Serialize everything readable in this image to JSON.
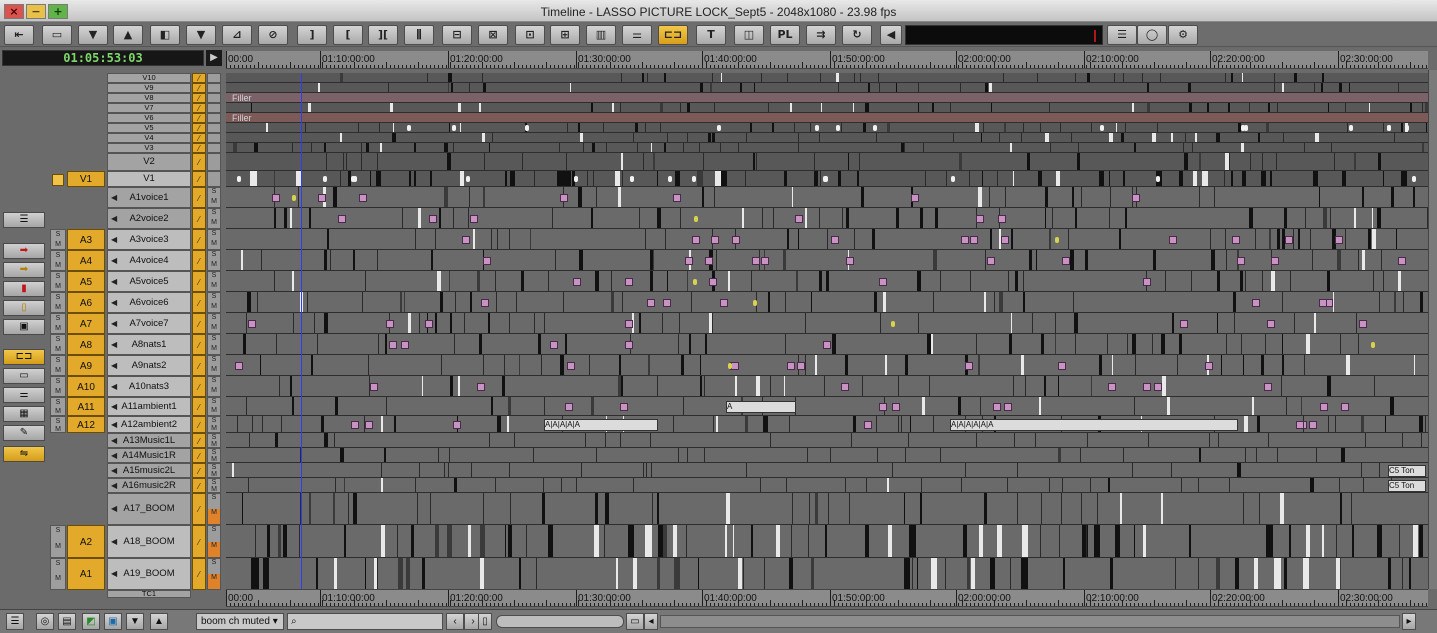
{
  "window": {
    "title": "Timeline - LASSO PICTURE LOCK_Sept5 - 2048x1080 - 23.98 fps",
    "close_label": "×",
    "minimize_label": "−",
    "maximize_label": "+"
  },
  "toolbar": {
    "buttons": [
      {
        "icon": "lift-icon",
        "glyph": "⇤"
      },
      {
        "icon": "clip-icon",
        "glyph": "▭"
      },
      {
        "icon": "down-arrow-icon",
        "glyph": "▼"
      },
      {
        "icon": "up-arrow-icon",
        "glyph": "▲"
      },
      {
        "icon": "split-icon",
        "glyph": "◧"
      },
      {
        "icon": "overwrite-icon",
        "glyph": "▼"
      },
      {
        "icon": "segment-icon",
        "glyph": "⊿"
      },
      {
        "icon": "no-entry-icon",
        "glyph": "⊘"
      },
      {
        "icon": "mark-out-icon",
        "glyph": "]"
      },
      {
        "icon": "mark-in-icon",
        "glyph": "["
      },
      {
        "icon": "mark-clip-icon",
        "glyph": "]["
      },
      {
        "icon": "clear-marks-icon",
        "glyph": "⫼"
      },
      {
        "icon": "extract-icon",
        "glyph": "⊟"
      },
      {
        "icon": "lift-segment-icon",
        "glyph": "⊠"
      },
      {
        "icon": "match-frame-icon",
        "glyph": "⊡"
      },
      {
        "icon": "trim-icon",
        "glyph": "⊞"
      },
      {
        "icon": "monitor-icon",
        "glyph": "▥"
      },
      {
        "icon": "mixer-icon",
        "glyph": "⚌"
      },
      {
        "icon": "link-icon",
        "glyph": "⊏⊐"
      },
      {
        "icon": "text-icon",
        "glyph": "T"
      },
      {
        "icon": "render-icon",
        "glyph": "◫"
      },
      {
        "icon": "pl-icon",
        "glyph": "PL"
      },
      {
        "icon": "sequence-icon",
        "glyph": "⇉"
      },
      {
        "icon": "refresh-icon",
        "glyph": "↻"
      },
      {
        "icon": "speaker-icon",
        "glyph": "◀"
      },
      {
        "icon": "list-icon",
        "glyph": "☰"
      },
      {
        "icon": "circle-icon",
        "glyph": "◯"
      },
      {
        "icon": "gear-icon",
        "glyph": "⚙"
      }
    ]
  },
  "timecode": "01:05:53:03",
  "ruler": {
    "labels": [
      "00:00",
      "01:10:00:00",
      "01:20:00:00",
      "01:30:00:00",
      "01:40:00:00",
      "01:50:00:00",
      "02:00:00:00",
      "02:10:00:00",
      "02:20:00:00",
      "02:30:00:00"
    ],
    "bottom_labels": [
      "00:00",
      "01:10:00:00",
      "01:20:00:00",
      "01:30:00:00",
      "01:40:00:00",
      "01:50:00:00",
      "02:00:00:00",
      "02:10:00:00",
      "02:20:00:00",
      "02:30:00:00"
    ]
  },
  "tracks": [
    {
      "name": "V10",
      "kind": "video"
    },
    {
      "name": "V9",
      "kind": "video"
    },
    {
      "name": "V8",
      "kind": "video"
    },
    {
      "name": "V7",
      "kind": "video"
    },
    {
      "name": "V6",
      "kind": "video"
    },
    {
      "name": "V5",
      "kind": "video"
    },
    {
      "name": "V4",
      "kind": "video"
    },
    {
      "name": "V3",
      "kind": "video"
    },
    {
      "name": "V2",
      "kind": "video"
    },
    {
      "name": "V1",
      "kind": "video",
      "patch": "V1"
    },
    {
      "name": "A1voice1",
      "kind": "audio"
    },
    {
      "name": "A2voice2",
      "kind": "audio"
    },
    {
      "name": "A3voice3",
      "kind": "audio",
      "patch": "A3"
    },
    {
      "name": "A4voice4",
      "kind": "audio",
      "patch": "A4"
    },
    {
      "name": "A5voice5",
      "kind": "audio",
      "patch": "A5"
    },
    {
      "name": "A6voice6",
      "kind": "audio",
      "patch": "A6"
    },
    {
      "name": "A7voice7",
      "kind": "audio",
      "patch": "A7"
    },
    {
      "name": "A8nats1",
      "kind": "audio",
      "patch": "A8"
    },
    {
      "name": "A9nats2",
      "kind": "audio",
      "patch": "A9"
    },
    {
      "name": "A10nats3",
      "kind": "audio",
      "patch": "A10"
    },
    {
      "name": "A11ambient1",
      "kind": "audio",
      "patch": "A11"
    },
    {
      "name": "A12ambient2",
      "kind": "audio",
      "patch": "A12"
    },
    {
      "name": "A13Music1L",
      "kind": "audio"
    },
    {
      "name": "A14Music1R",
      "kind": "audio"
    },
    {
      "name": "A15music2L",
      "kind": "audio"
    },
    {
      "name": "A16music2R",
      "kind": "audio"
    },
    {
      "name": "A17_BOOM",
      "kind": "audio"
    },
    {
      "name": "A18_BOOM",
      "kind": "audio",
      "patch": "A2"
    },
    {
      "name": "A19_BOOM",
      "kind": "audio",
      "patch": "A1"
    },
    {
      "name": "TC1",
      "kind": "timecode"
    }
  ],
  "filler_labels": {
    "v8": "Filler",
    "v6": "Filler"
  },
  "clip_labels": {
    "a11_1": "A",
    "a12_1": "A|A|A|A|A",
    "a12_2": "A|A|A|A|A|A",
    "a15": "C5 Ton",
    "a16": "C5 Ton"
  },
  "solo_label": "S",
  "mute_label": "M",
  "bottom": {
    "track_select": "boom ch muted",
    "find_placeholder": ""
  },
  "colors": {
    "track_patch": "#e2a92a",
    "playhead": "#2f3cff",
    "timecode": "#7fd86a"
  }
}
